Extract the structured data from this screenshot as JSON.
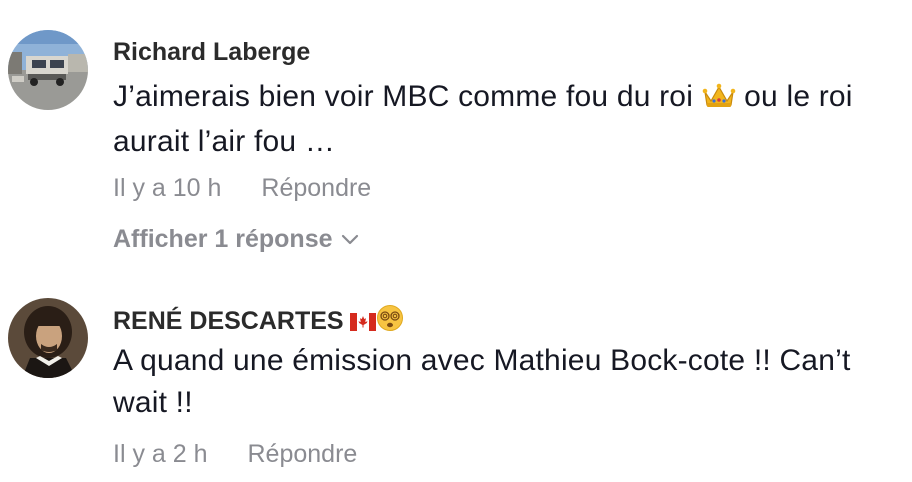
{
  "comments": [
    {
      "username": "Richard Laberge",
      "text_before": "J’aimerais bien voir MBC comme fou du roi",
      "text_after": " ou le roi aurait l’air fou …",
      "emoji_icon": "crown-icon",
      "timestamp": "Il y a 10 h",
      "reply_label": "Répondre",
      "view_replies_label": "Afficher 1 réponse"
    },
    {
      "username": "RENÉ DESCARTES",
      "username_icons": [
        "canada-flag-icon",
        "dizzy-face-icon"
      ],
      "text": "A quand une émission avec Mathieu Bock-cote !! Can’t wait !!",
      "timestamp": "Il y a 2 h",
      "reply_label": "Répondre"
    }
  ],
  "colors": {
    "text": "#161823",
    "meta": "#8a8b91"
  }
}
